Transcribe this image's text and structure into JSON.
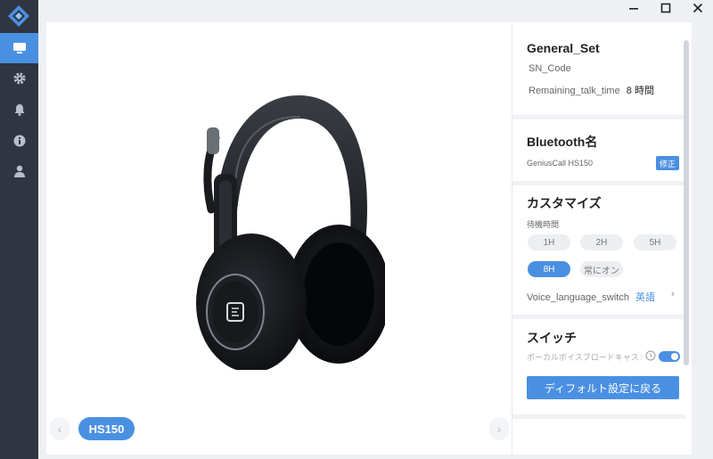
{
  "nav": {
    "items": [
      {
        "icon": "monitor-icon",
        "active": true
      },
      {
        "icon": "gear-icon",
        "active": false
      },
      {
        "icon": "bell-icon",
        "active": false
      },
      {
        "icon": "info-icon",
        "active": false
      },
      {
        "icon": "user-icon",
        "active": false
      }
    ]
  },
  "window": {
    "minimize": "–",
    "maximize": "□",
    "close": "×"
  },
  "device": {
    "model": "HS150"
  },
  "general": {
    "title": "General_Set",
    "sn_label": "SN_Code",
    "talk_label": "Remaining_talk_time",
    "talk_value": "8 時間"
  },
  "bluetooth": {
    "title": "Bluetooth名",
    "name": "GeniusCall HS150",
    "edit_label": "修正"
  },
  "customize": {
    "title": "カスタマイズ",
    "standby_label": "待機時間",
    "options": [
      "1H",
      "2H",
      "5H",
      "8H",
      "常にオン"
    ],
    "selected": "8H",
    "voice_label": "Voice_language_switch",
    "voice_value": "英語"
  },
  "switch": {
    "title": "スイッチ",
    "vocal_label": "ボーカルボイスブロードキャスト",
    "vocal_on": true
  },
  "default_button": "ディフォルト設定に戻る",
  "colors": {
    "accent": "#4a90e2",
    "sidebar": "#2f3541"
  }
}
